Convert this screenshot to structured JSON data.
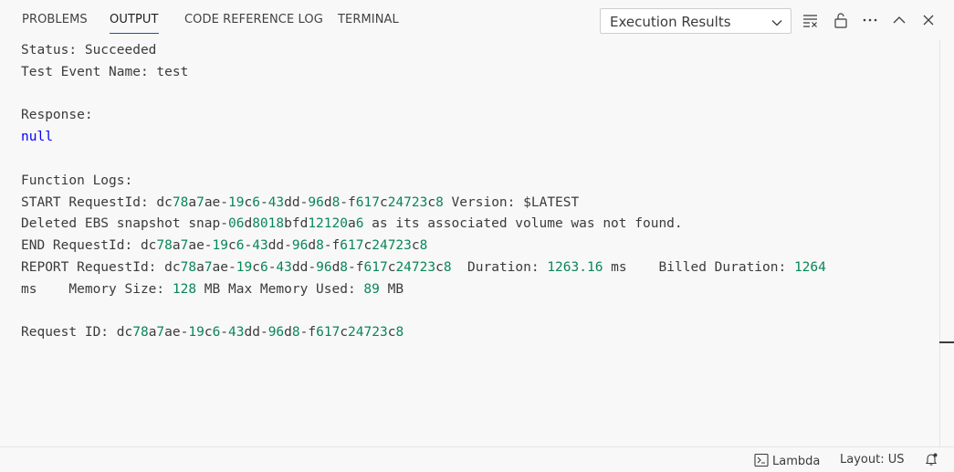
{
  "panel": {
    "tabs": [
      {
        "label": "PROBLEMS"
      },
      {
        "label": "OUTPUT"
      },
      {
        "label": "CODE REFERENCE LOG"
      },
      {
        "label": "TERMINAL"
      }
    ],
    "active_tab": "OUTPUT",
    "channel_select": {
      "value": "Execution Results"
    },
    "actions": [
      "clear-output-icon",
      "lock-icon",
      "more-actions-icon",
      "maximize-panel-icon",
      "close-icon"
    ]
  },
  "output": {
    "lines": [
      [
        {
          "t": "Status: Succeeded"
        }
      ],
      [
        {
          "t": "Test Event Name: test"
        }
      ],
      [],
      [
        {
          "t": "Response:"
        }
      ],
      [
        {
          "t": "null",
          "c": "kw"
        }
      ],
      [],
      [
        {
          "t": "Function Logs:"
        }
      ],
      [
        {
          "t": "START RequestId: dc"
        },
        {
          "t": "78",
          "c": "num"
        },
        {
          "t": "a"
        },
        {
          "t": "7",
          "c": "num"
        },
        {
          "t": "ae-"
        },
        {
          "t": "19",
          "c": "num"
        },
        {
          "t": "c"
        },
        {
          "t": "6",
          "c": "num"
        },
        {
          "t": "-"
        },
        {
          "t": "43",
          "c": "num"
        },
        {
          "t": "dd-"
        },
        {
          "t": "96",
          "c": "num"
        },
        {
          "t": "d"
        },
        {
          "t": "8",
          "c": "num"
        },
        {
          "t": "-f"
        },
        {
          "t": "617",
          "c": "num"
        },
        {
          "t": "c"
        },
        {
          "t": "24723",
          "c": "num"
        },
        {
          "t": "c"
        },
        {
          "t": "8",
          "c": "num"
        },
        {
          "t": " Version: $LATEST"
        }
      ],
      [
        {
          "t": "Deleted EBS snapshot snap-"
        },
        {
          "t": "06",
          "c": "num"
        },
        {
          "t": "d"
        },
        {
          "t": "8018",
          "c": "num"
        },
        {
          "t": "bfd"
        },
        {
          "t": "12120",
          "c": "num"
        },
        {
          "t": "a"
        },
        {
          "t": "6",
          "c": "num"
        },
        {
          "t": " as its associated volume was not found."
        }
      ],
      [
        {
          "t": "END RequestId: dc"
        },
        {
          "t": "78",
          "c": "num"
        },
        {
          "t": "a"
        },
        {
          "t": "7",
          "c": "num"
        },
        {
          "t": "ae-"
        },
        {
          "t": "19",
          "c": "num"
        },
        {
          "t": "c"
        },
        {
          "t": "6",
          "c": "num"
        },
        {
          "t": "-"
        },
        {
          "t": "43",
          "c": "num"
        },
        {
          "t": "dd-"
        },
        {
          "t": "96",
          "c": "num"
        },
        {
          "t": "d"
        },
        {
          "t": "8",
          "c": "num"
        },
        {
          "t": "-f"
        },
        {
          "t": "617",
          "c": "num"
        },
        {
          "t": "c"
        },
        {
          "t": "24723",
          "c": "num"
        },
        {
          "t": "c"
        },
        {
          "t": "8",
          "c": "num"
        }
      ],
      [
        {
          "t": "REPORT RequestId: dc"
        },
        {
          "t": "78",
          "c": "num"
        },
        {
          "t": "a"
        },
        {
          "t": "7",
          "c": "num"
        },
        {
          "t": "ae-"
        },
        {
          "t": "19",
          "c": "num"
        },
        {
          "t": "c"
        },
        {
          "t": "6",
          "c": "num"
        },
        {
          "t": "-"
        },
        {
          "t": "43",
          "c": "num"
        },
        {
          "t": "dd-"
        },
        {
          "t": "96",
          "c": "num"
        },
        {
          "t": "d"
        },
        {
          "t": "8",
          "c": "num"
        },
        {
          "t": "-f"
        },
        {
          "t": "617",
          "c": "num"
        },
        {
          "t": "c"
        },
        {
          "t": "24723",
          "c": "num"
        },
        {
          "t": "c"
        },
        {
          "t": "8",
          "c": "num"
        },
        {
          "t": "  Duration: "
        },
        {
          "t": "1263.16",
          "c": "num"
        },
        {
          "t": " ms    Billed Duration: "
        },
        {
          "t": "1264",
          "c": "num"
        }
      ],
      [
        {
          "t": "ms    Memory Size: "
        },
        {
          "t": "128",
          "c": "num"
        },
        {
          "t": " MB Max Memory Used: "
        },
        {
          "t": "89",
          "c": "num"
        },
        {
          "t": " MB"
        }
      ],
      [],
      [
        {
          "t": "Request ID: dc"
        },
        {
          "t": "78",
          "c": "num"
        },
        {
          "t": "a"
        },
        {
          "t": "7",
          "c": "num"
        },
        {
          "t": "ae-"
        },
        {
          "t": "19",
          "c": "num"
        },
        {
          "t": "c"
        },
        {
          "t": "6",
          "c": "num"
        },
        {
          "t": "-"
        },
        {
          "t": "43",
          "c": "num"
        },
        {
          "t": "dd-"
        },
        {
          "t": "96",
          "c": "num"
        },
        {
          "t": "d"
        },
        {
          "t": "8",
          "c": "num"
        },
        {
          "t": "-f"
        },
        {
          "t": "617",
          "c": "num"
        },
        {
          "t": "c"
        },
        {
          "t": "24723",
          "c": "num"
        },
        {
          "t": "c"
        },
        {
          "t": "8",
          "c": "num"
        }
      ]
    ]
  },
  "statusbar": {
    "lambda_label": "Lambda",
    "layout_label": "Layout: US"
  },
  "colors": {
    "keyword": "#0000ff",
    "number": "#098658",
    "text": "#3b3b3b",
    "accent": "#005fb8"
  }
}
